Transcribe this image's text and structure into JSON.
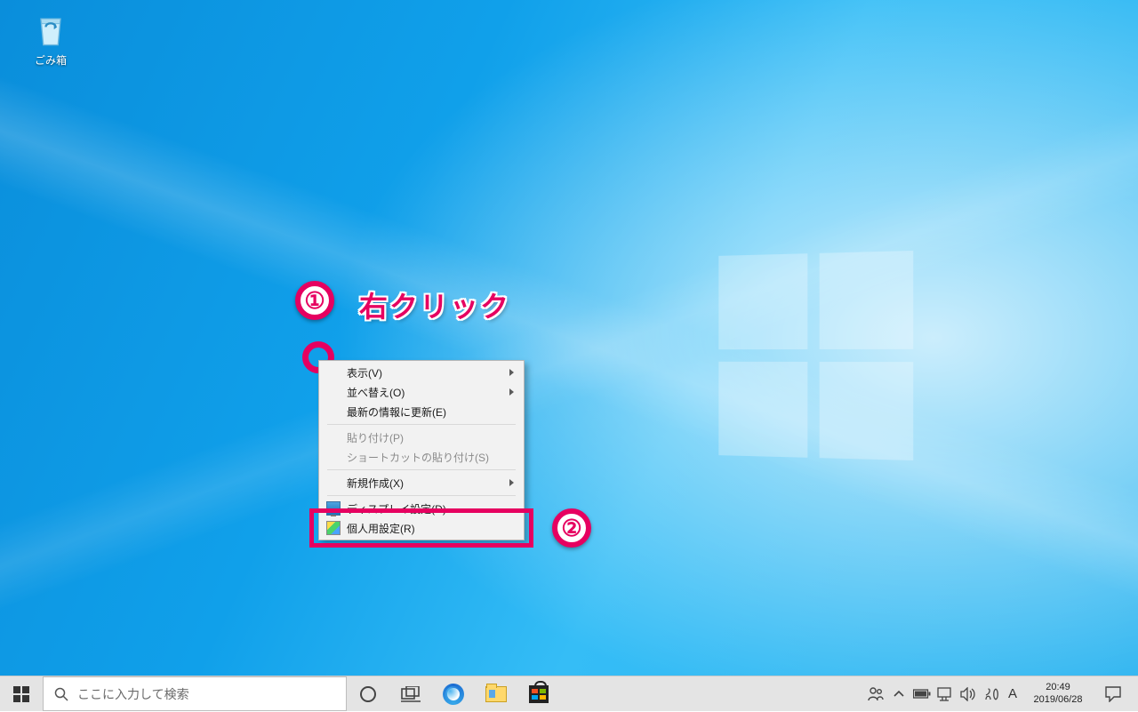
{
  "desktop": {
    "recycle_bin_label": "ごみ箱"
  },
  "annotations": {
    "step1_badge": "①",
    "step1_text": "右クリック",
    "step2_badge": "②"
  },
  "context_menu": {
    "view": "表示(V)",
    "sort": "並べ替え(O)",
    "refresh": "最新の情報に更新(E)",
    "paste": "貼り付け(P)",
    "paste_shortcut": "ショートカットの貼り付け(S)",
    "new": "新規作成(X)",
    "display_settings": "ディスプレイ設定(D)",
    "personalize": "個人用設定(R)"
  },
  "taskbar": {
    "search_placeholder": "ここに入力して検索",
    "ime_letter": "A",
    "time": "20:49",
    "date": "2019/06/28"
  }
}
